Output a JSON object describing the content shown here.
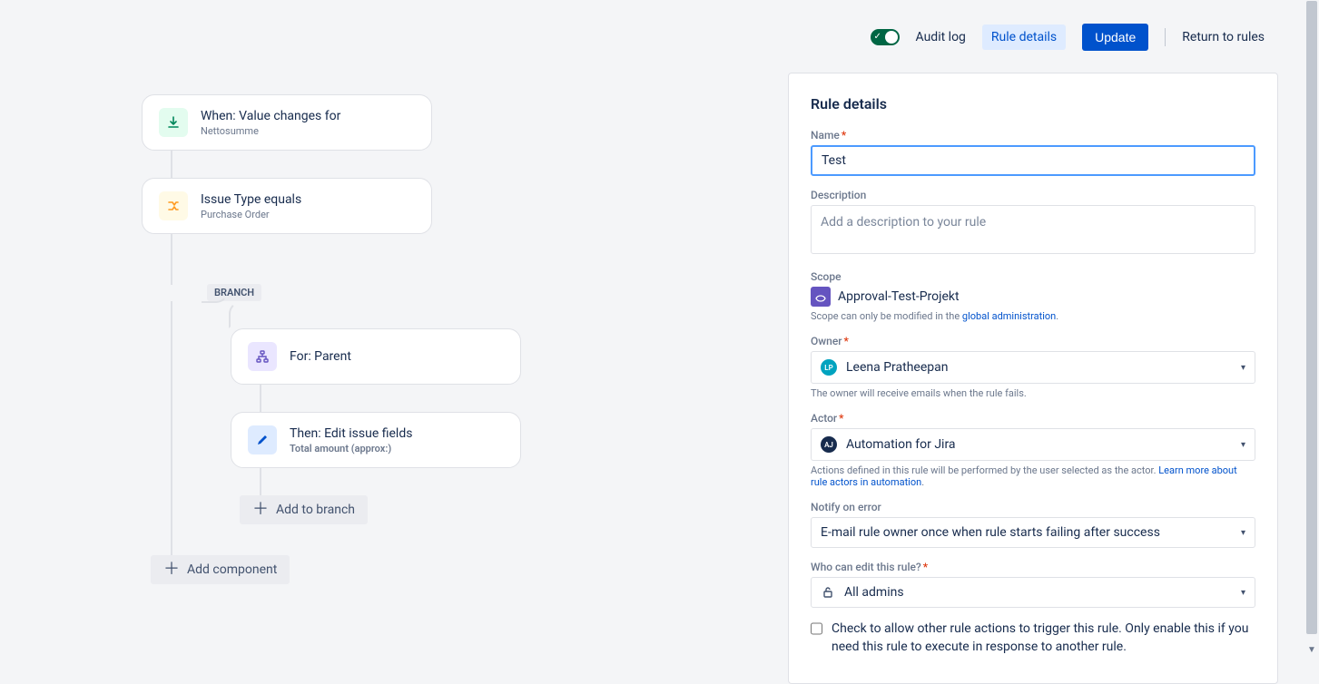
{
  "topbar": {
    "audit_log": "Audit log",
    "rule_details": "Rule details",
    "update": "Update",
    "return": "Return to rules",
    "toggle_enabled": true
  },
  "flow": {
    "trigger": {
      "title": "When: Value changes for",
      "sub": "Nettosumme"
    },
    "condition": {
      "title": "Issue Type equals",
      "sub": "Purchase Order"
    },
    "branch_label": "BRANCH",
    "branch_for": {
      "title": "For: Parent"
    },
    "action": {
      "title": "Then: Edit issue fields",
      "sub": "Total amount (approx:)"
    },
    "add_branch": "Add to branch",
    "add_component": "Add component"
  },
  "panel": {
    "title": "Rule details",
    "name_label": "Name",
    "name_value": "Test",
    "description_label": "Description",
    "description_placeholder": "Add a description to your rule",
    "scope_label": "Scope",
    "scope_project": "Approval-Test-Projekt",
    "scope_help_prefix": "Scope can only be modified in the ",
    "scope_help_link": "global administration",
    "owner_label": "Owner",
    "owner_name": "Leena Pratheepan",
    "owner_help": "The owner will receive emails when the rule fails.",
    "actor_label": "Actor",
    "actor_name": "Automation for Jira",
    "actor_help_prefix": "Actions defined in this rule will be performed by the user selected as the actor. ",
    "actor_help_link": "Learn more about rule actors in automation",
    "notify_label": "Notify on error",
    "notify_value": "E-mail rule owner once when rule starts failing after success",
    "edit_label": "Who can edit this rule?",
    "edit_value": "All admins",
    "checkbox_text": "Check to allow other rule actions to trigger this rule. Only enable this if you need this rule to execute in response to another rule."
  }
}
